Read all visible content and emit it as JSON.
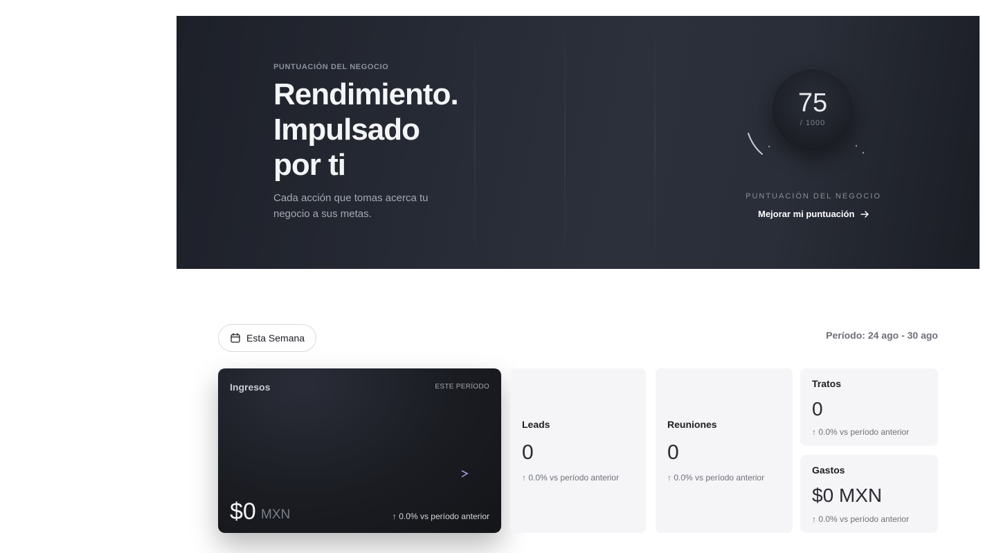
{
  "hero": {
    "eyebrow": "PUNTUACIÓN DEL NEGOCIO",
    "title_lines": [
      "Rendimiento.",
      "Impulsado",
      "por ti"
    ],
    "subtitle": "Cada acción que tomas acerca tu negocio a sus metas.",
    "score": {
      "value": "75",
      "max": "/ 1000",
      "label": "PUNTUACIÓN DEL NEGOCIO",
      "link_label": "Mejorar mi puntuación"
    }
  },
  "toolbar": {
    "period_button_label": "Esta Semana",
    "period_range": "Período: 24 ago - 30 ago"
  },
  "cards": {
    "ingresos": {
      "title": "Ingresos",
      "tag": "ESTE PERÍODO",
      "amount": "$0",
      "currency": "MXN",
      "delta": "↑ 0.0% vs período anterior"
    },
    "leads": {
      "title": "Leads",
      "value": "0",
      "delta": "↑ 0.0% vs período anterior"
    },
    "reuniones": {
      "title": "Reuniones",
      "value": "0",
      "delta": "↑ 0.0% vs período anterior"
    },
    "tratos": {
      "title": "Tratos",
      "value": "0",
      "delta": "↑ 0.0% vs período anterior"
    },
    "gastos": {
      "title": "Gastos",
      "value": "$0 MXN",
      "delta": "↑ 0.0% vs período anterior"
    }
  },
  "colors": {
    "hero_bg": "#272b35",
    "card_light_bg": "#f5f5f7",
    "accent_line": "#8e93c9"
  }
}
